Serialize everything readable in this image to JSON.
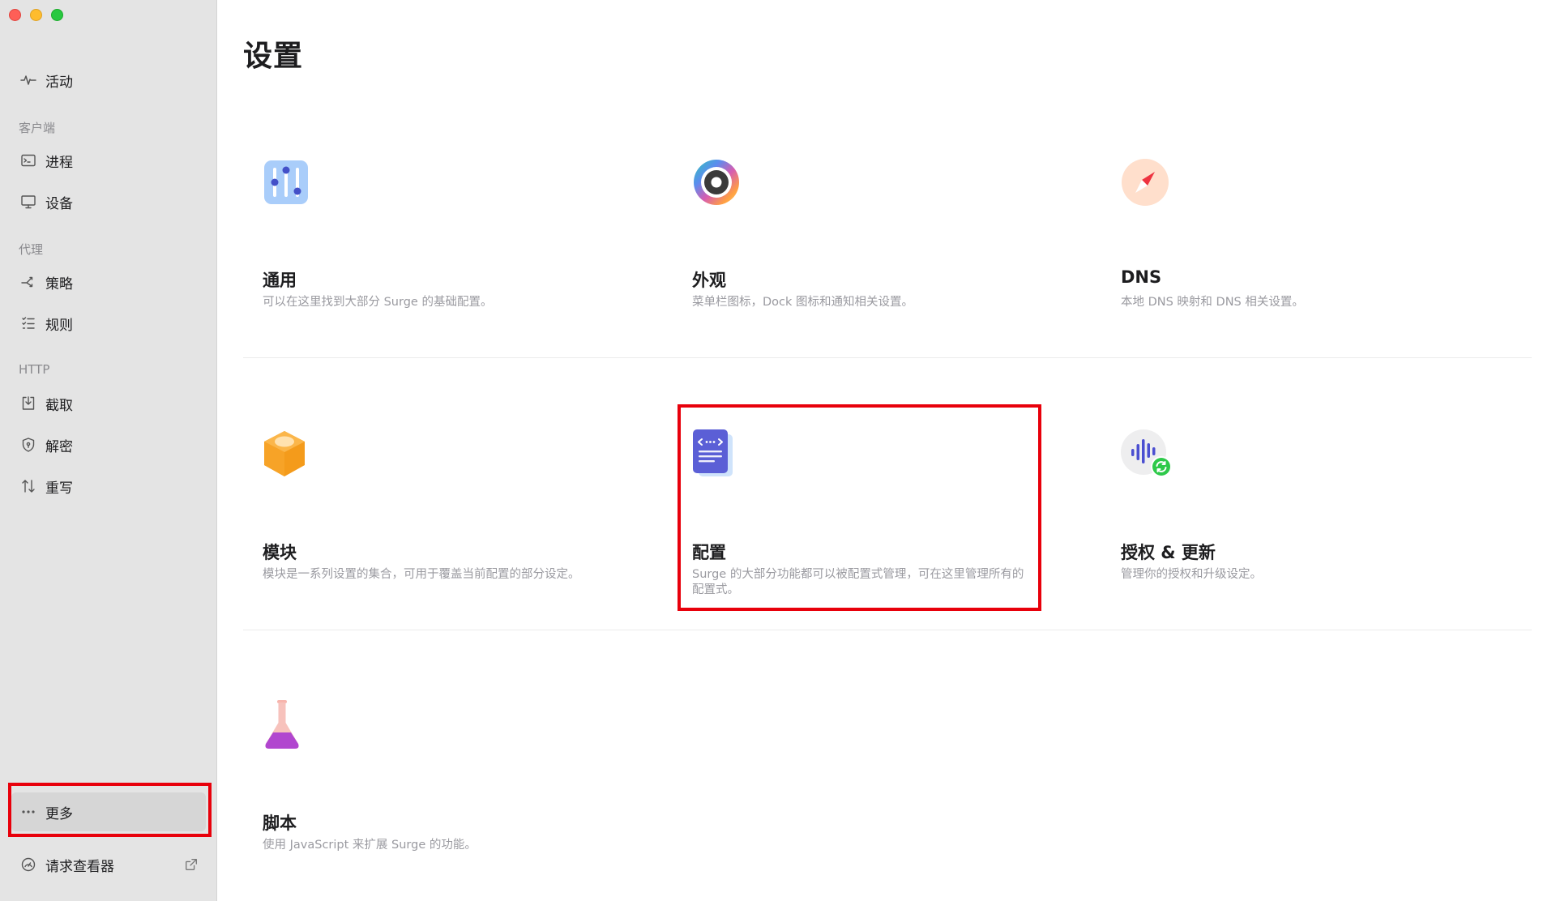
{
  "sidebar": {
    "activity": "活动",
    "section_client": "客户端",
    "process": "进程",
    "devices": "设备",
    "section_proxy": "代理",
    "policy": "策略",
    "rules": "规则",
    "section_http": "HTTP",
    "capture": "截取",
    "decrypt": "解密",
    "rewrite": "重写",
    "more": "更多",
    "request_viewer": "请求查看器"
  },
  "main": {
    "title": "设置",
    "cards": [
      {
        "title": "通用",
        "desc": "可以在这里找到大部分 Surge 的基础配置。",
        "icon": "sliders-icon"
      },
      {
        "title": "外观",
        "desc": "菜单栏图标，Dock 图标和通知相关设置。",
        "icon": "appearance-icon"
      },
      {
        "title": "DNS",
        "desc": "本地 DNS 映射和 DNS 相关设置。",
        "icon": "compass-icon"
      },
      {
        "title": "模块",
        "desc": "模块是一系列设置的集合，可用于覆盖当前配置的部分设定。",
        "icon": "module-box-icon"
      },
      {
        "title": "配置",
        "desc": "Surge 的大部分功能都可以被配置式管理，可在这里管理所有的配置式。",
        "icon": "config-document-icon"
      },
      {
        "title": "授权 & 更新",
        "desc": "管理你的授权和升级设定。",
        "icon": "license-update-icon"
      },
      {
        "title": "脚本",
        "desc": "使用 JavaScript 来扩展 Surge 的功能。",
        "icon": "flask-icon"
      }
    ]
  },
  "colors": {
    "highlight_box": "#e8000b",
    "sidebar_bg": "#e4e4e4"
  }
}
